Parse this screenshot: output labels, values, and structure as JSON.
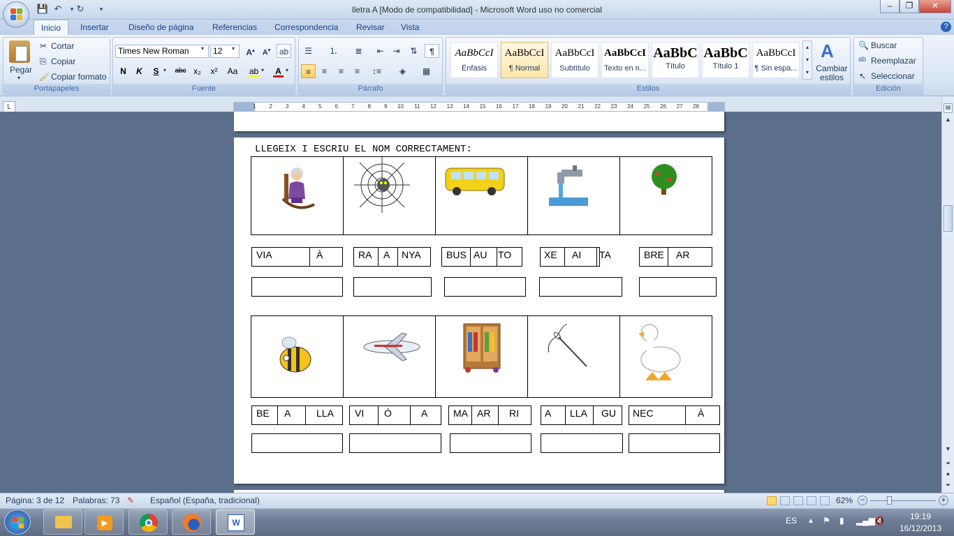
{
  "window": {
    "title": "lletra A [Modo de compatibilidad] - Microsoft Word uso no comercial",
    "minimize": "–",
    "maximize": "❐",
    "close": "✕"
  },
  "tabs": [
    "Inicio",
    "Insertar",
    "Diseño de página",
    "Referencias",
    "Correspondencia",
    "Revisar",
    "Vista"
  ],
  "ribbon": {
    "clipboard": {
      "title": "Portapapeles",
      "paste": "Pegar",
      "cut": "Cortar",
      "copy": "Copiar",
      "format_painter": "Copiar formato"
    },
    "font": {
      "title": "Fuente",
      "family": "Times New Roman",
      "size": "12",
      "bold": "N",
      "italic": "K",
      "underline": "S",
      "strike": "abc",
      "sub": "x₂",
      "sup": "x²",
      "case": "Aa"
    },
    "paragraph": {
      "title": "Párrafo"
    },
    "styles": {
      "title": "Estilos",
      "change": "Cambiar estilos",
      "items": [
        {
          "preview": "AaBbCcI",
          "label": "Énfasis"
        },
        {
          "preview": "AaBbCcI",
          "label": "¶ Normal"
        },
        {
          "preview": "AaBbCcI",
          "label": "Subtítulo"
        },
        {
          "preview": "AaBbCcI",
          "label": "Texto en n..."
        },
        {
          "preview": "AaBbC",
          "label": "Título"
        },
        {
          "preview": "AaBbC",
          "label": "Título 1"
        },
        {
          "preview": "AaBbCcI",
          "label": "¶ Sin espa..."
        }
      ]
    },
    "editing": {
      "title": "Edición",
      "find": "Buscar",
      "replace": "Reemplazar",
      "select": "Seleccionar"
    }
  },
  "document": {
    "heading": "LLEGEIX I ESCRIU EL NOM CORRECTAMENT:",
    "row1_images": [
      "grandmother-rocking-chair",
      "spider-web",
      "bus",
      "water-tap",
      "tree"
    ],
    "row1_syllables": [
      [
        "VIA",
        "À"
      ],
      [
        "RA",
        "A",
        "NYA"
      ],
      [
        "BUS",
        "AU",
        "TO"
      ],
      [
        "XE",
        "AI",
        "TA"
      ],
      [
        "BRE",
        "AR"
      ]
    ],
    "row2_images": [
      "bee",
      "airplane",
      "wardrobe",
      "needle",
      "duck"
    ],
    "row2_syllables": [
      [
        "BE",
        "A",
        "LLA"
      ],
      [
        "VI",
        "Ó",
        "A"
      ],
      [
        "MA",
        "AR",
        "RI"
      ],
      [
        "A",
        "LLA",
        "GU"
      ],
      [
        "NEC",
        "À"
      ]
    ]
  },
  "statusbar": {
    "page": "Página: 3 de 12",
    "words": "Palabras: 73",
    "language": "Español (España, tradicional)",
    "zoom": "62%"
  },
  "taskbar": {
    "lang": "ES",
    "time": "19:19",
    "date": "16/12/2013"
  }
}
